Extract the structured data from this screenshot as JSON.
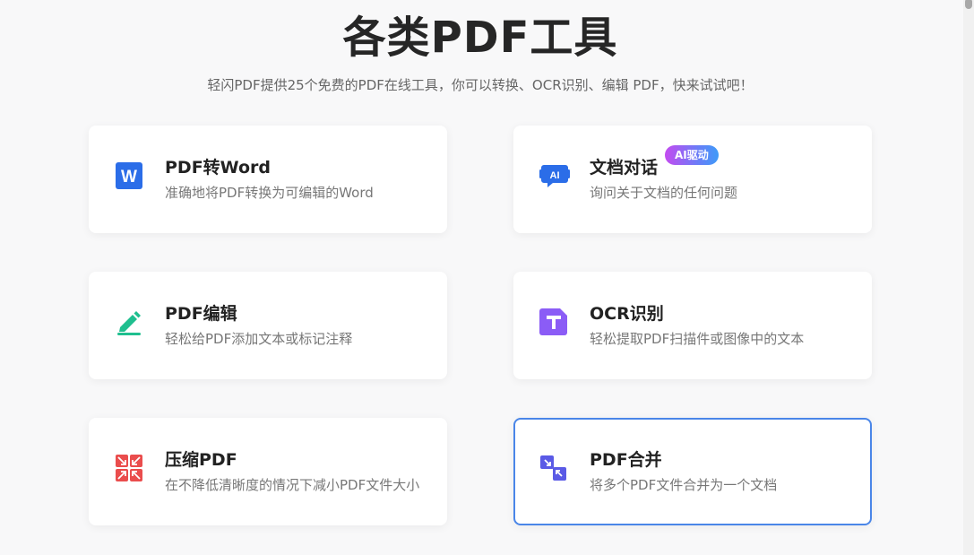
{
  "header": {
    "title": "各类PDF工具",
    "subtitle": "轻闪PDF提供25个免费的PDF在线工具，你可以转换、OCR识别、编辑 PDF，快来试试吧！"
  },
  "tools": [
    {
      "name": "PDF转Word",
      "desc": "准确地将PDF转换为可编辑的Word",
      "icon": "word-icon",
      "color": "#2b6de8"
    },
    {
      "name": "文档对话",
      "desc": "询问关于文档的任何问题",
      "icon": "ai-chat-icon",
      "color": "#2b6de8",
      "badge": "AI驱动"
    },
    {
      "name": "PDF编辑",
      "desc": "轻松给PDF添加文本或标记注释",
      "icon": "pencil-icon",
      "color": "#1fbf8f"
    },
    {
      "name": "OCR识别",
      "desc": "轻松提取PDF扫描件或图像中的文本",
      "icon": "text-recognition-icon",
      "color": "#8b5cf6"
    },
    {
      "name": "压缩PDF",
      "desc": "在不降低清晰度的情况下减小PDF文件大小",
      "icon": "compress-icon",
      "color": "#ea4d4d"
    },
    {
      "name": "PDF合并",
      "desc": "将多个PDF文件合并为一个文档",
      "icon": "merge-icon",
      "color": "#5a5ae6"
    }
  ],
  "colors": {
    "active_border": "#4a86e8",
    "badge_gradient_start": "#c44bf0",
    "badge_gradient_end": "#3e9bf8"
  }
}
